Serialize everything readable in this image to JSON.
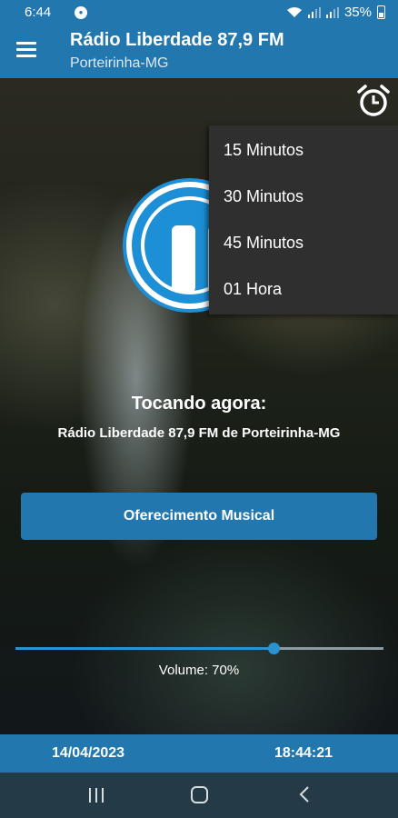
{
  "status_bar": {
    "time": "6:44",
    "battery": "35%",
    "icons": [
      "app-notification-icon",
      "wifi-icon",
      "signal-icon",
      "signal-icon",
      "battery-icon"
    ]
  },
  "app_bar": {
    "title": "Rádio Liberdade 87,9 FM",
    "subtitle": "Porteirinha-MG",
    "menu_icon": "hamburger-menu-icon",
    "color": "#2277ae"
  },
  "player": {
    "state_icon": "pause-icon",
    "accent": "#1d8fd6"
  },
  "sleep_timer": {
    "icon": "alarm-clock-icon",
    "options": [
      "15 Minutos",
      "30 Minutos",
      "45 Minutos",
      "01 Hora"
    ]
  },
  "now_playing": {
    "label": "Tocando agora:",
    "info": "Rádio Liberdade 87,9 FM de Porteirinha-MG"
  },
  "offer_button": {
    "label": "Oferecimento Musical"
  },
  "volume": {
    "label": "Volume: 70%",
    "level": 0.7
  },
  "footer": {
    "date": "14/04/2023",
    "time": "18:44:21"
  },
  "nav_bar": {
    "icons": [
      "recent-apps-icon",
      "home-icon",
      "back-icon"
    ]
  }
}
